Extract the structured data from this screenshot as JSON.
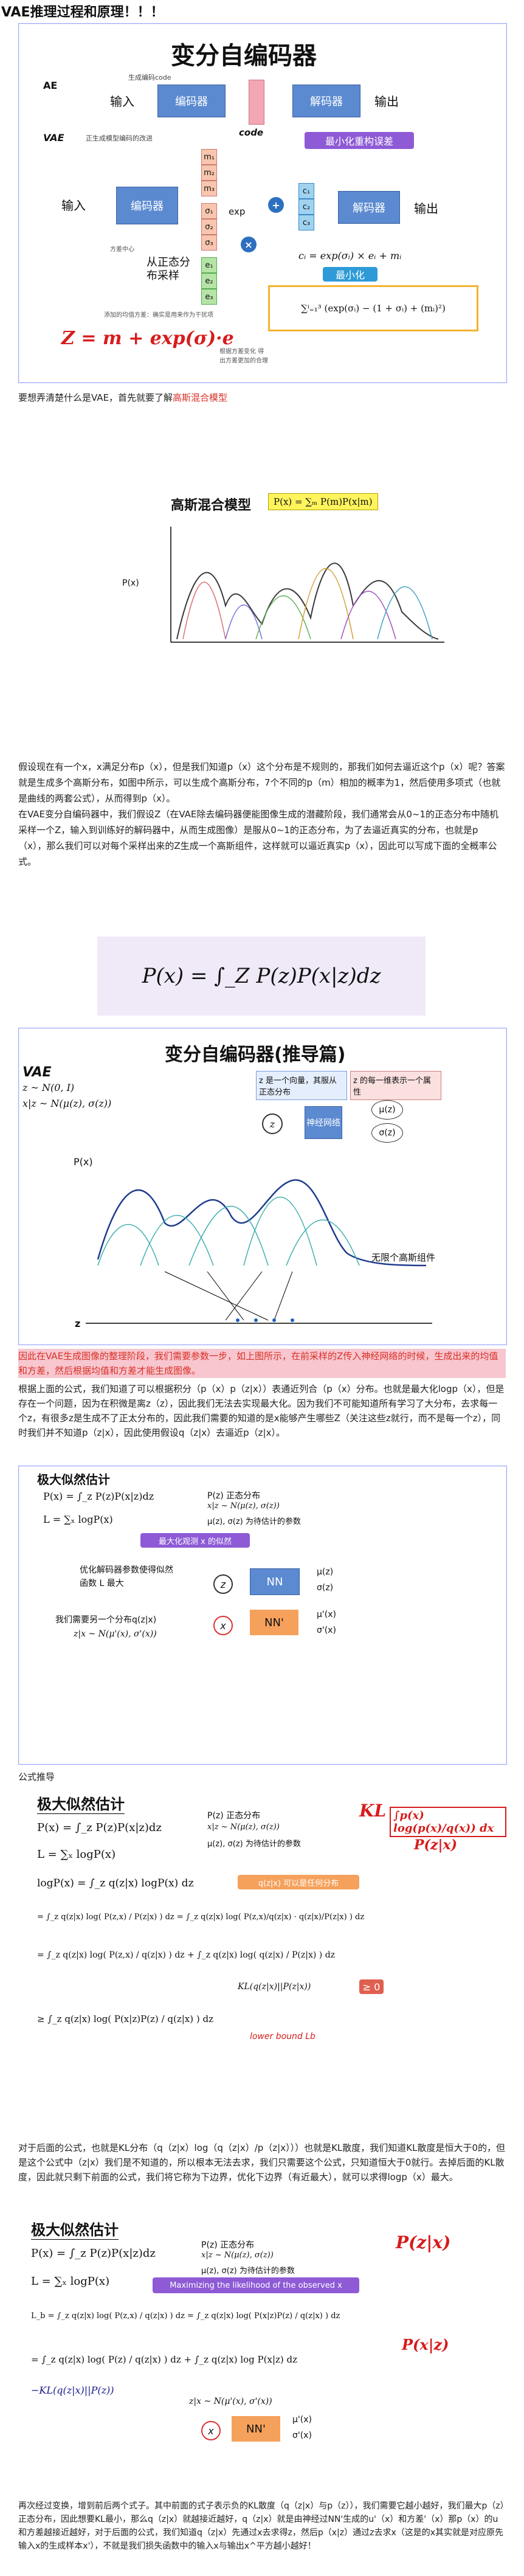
{
  "header": {
    "title": "VAE推理过程和原理！！！"
  },
  "slide1": {
    "title": "变分自编码器",
    "ae_label": "AE",
    "vae_label": "VAE",
    "gen_code_note": "生成编码code",
    "input": "输入",
    "encoder": "编码器",
    "code": "code",
    "decoder": "解码器",
    "output": "输出",
    "min_error": "最小化重构误差",
    "vae_gen_note": "正生成模型编码的改进",
    "means": [
      "m₁",
      "m₂",
      "m₃"
    ],
    "sigmas": [
      "σ₁",
      "σ₂",
      "σ₃"
    ],
    "es": [
      "e₁",
      "e₂",
      "e₃"
    ],
    "cs": [
      "c₁",
      "c₂",
      "c₃"
    ],
    "exp": "exp",
    "normal_sample": "从正态分布采样",
    "formula_c": "cᵢ = exp(σᵢ) × eᵢ + mᵢ",
    "minimize": "最小化",
    "loss": "∑ⁱ₌₁³ (exp(σᵢ) − (1 + σᵢ) + (mᵢ)²)",
    "handwritten": "Z = m + exp(σ)·e",
    "note_left": "方差中心",
    "note_bottom": "添加的均值方差：确实是用来作为干扰项",
    "note_right": "根据方差变化 得出方差更加的合理"
  },
  "para1": {
    "text": "要想弄清楚什么是VAE，首先就要了解",
    "red": "高斯混合模型"
  },
  "slide2": {
    "title": "高斯混合模型",
    "formula": "P(x) = ∑ₘ P(m)P(x|m)",
    "ylabel": "P(x)"
  },
  "para2": "假设现在有一个x，x满足分布p（x），但是我们知道p（x）这个分布是不规则的，那我们如何去逼近这个p（x）呢？答案就是生成多个高斯分布，如图中所示，可以生成个高斯分布，7个不同的p（m）相加的概率为1，然后使用多项式（也就是曲线的两套公式），从而得到p（x）。\n在VAE变分自编码器中，我们假设Z（在VAE除去编码器便能图像生成的潜藏阶段，我们通常会从0~1的正态分布中随机采样一个Z，输入到训练好的解码器中，从而生成图像）是服从0~1的正态分布，为了去逼近真实的分布，也就是p（x），那么我们可以对每个采样出来的Z生成一个高斯组件，这样就可以逼近真实p（x），因此可以写成下面的全概率公式。",
  "slide3": {
    "formula": "P(x) = ∫_Z P(z)P(x|z)dz"
  },
  "slide4": {
    "title": "变分自编码器(推导篇)",
    "vae": "VAE",
    "z_dist": "z ~ N(0, I)",
    "xz_dist": "x|z ~ N(μ(z), σ(z))",
    "note1": "z 是一个向量，其服从正态分布",
    "note2": "z 的每一维表示一个属性",
    "nn": "神经网络",
    "mu": "μ(z)",
    "sigma": "σ(z)",
    "px": "P(x)",
    "inf": "无限个高斯组件",
    "zaxis": "z"
  },
  "para3": {
    "red": "因此在VAE生成图像的整理阶段，我们需要参数一步，如上图所示，在前采样的Z传入神经网络的时候，生成出来的均值和方差，然后根据均值和方差才能生成图像。",
    "text": "根据上面的公式，我们知道了可以根据积分（p（x）p（z|x））表通近列合（p（x）分布。也就是最大化logp（x），但是存在一个问题，因为在积微是离z（z），因此我们无法去实现最大化。因为我们不可能知道所有学习了大分布，去求每一个z，有很多z是生成不了正太分布的，因此我们需要的知道的是x能够产生哪些Z（关注这些z就行，而不是每一个z），同时我们并不知道p（z|x），因此使用假设q（z|x）去逼近p（z|x）。"
  },
  "slide5": {
    "title": "极大似然估计",
    "f1": "P(x) = ∫_z P(z)P(x|z)dz",
    "f2": "L = ∑ₓ logP(x)",
    "pz": "P(z) 正态分布",
    "xz": "x|z ~ N(μ(z), σ(z))",
    "params": "μ(z), σ(z) 为待估计的参数",
    "maximize": "最大化观测 x 的似然",
    "opt": "优化解码器参数使得似然函数 L 最大",
    "need": "我们需要另一个分布q(z|x)",
    "nn": "NN",
    "nnp": "NN'",
    "mu": "μ(z)",
    "sigma": "σ(z)",
    "mup": "μ'(x)",
    "sigmap": "σ'(x)",
    "qzx": "z|x ~ N(μ'(x), σ'(x))",
    "z": "z",
    "x": "x"
  },
  "para4": "公式推导",
  "slide6": {
    "title": "极大似然估计",
    "f1": "P(x) = ∫_z P(z)P(x|z)dz",
    "f2": "L = ∑ₓ logP(x)",
    "pz": "P(z) 正态分布",
    "xz": "x|z ~ N(μ(z), σ(z))",
    "params": "μ(z), σ(z) 为待估计的参数",
    "logp1": "logP(x) = ∫_z q(z|x) logP(x) dz",
    "any": "q(z|x) 可以是任何分布",
    "logp2": "= ∫_z q(z|x) log( P(z,x) / P(z|x) ) dz = ∫_z q(z|x) log( P(z,x)/q(z|x) · q(z|x)/P(z|x) ) dz",
    "logp3": "= ∫_z q(z|x) log( P(z,x) / q(z|x) ) dz + ∫_z q(z|x) log( q(z|x) / P(z|x) ) dz",
    "kl": "KL(q(z|x)||P(z|x))",
    "ge0": "≥ 0",
    "logp4": "≥ ∫_z q(z|x) log( P(x|z)P(z) / q(z|x) ) dz",
    "lb": "lower bound  Lb",
    "hw1": "KL",
    "hw2": "∫p(x) log(p(x)/q(x)) dx",
    "hw3": "P(z|x)"
  },
  "para5": "对于后面的公式，也就是KL分布（q（z|x）log（q（z|x）/p（z|x）））也就是KL散度，我们知道KL散度是恒大于0的，但是这个公式中（z|x）我们是不知道的，所以根本无法去求，我们只需要这个公式，只知道恒大于0就行。去掉后面的KL散度，因此就只剩下前面的公式，我们将它称为下边界，优化下边界（有近最大），就可以求得logp（x）最大。",
  "slide7": {
    "title": "极大似然估计",
    "f1": "P(x) = ∫_z P(z)P(x|z)dz",
    "f2": "L = ∑ₓ logP(x)",
    "pz": "P(z) 正态分布",
    "xz": "x|z ~ N(μ(z), σ(z))",
    "params": "μ(z), σ(z) 为待估计的参数",
    "maxlabel": "Maximizing the likelihood of the observed x",
    "lb": "L_b = ∫_z q(z|x) log( P(z,x) / q(z|x) ) dz = ∫_z q(z|x) log( P(x|z)P(z) / q(z|x) ) dz",
    "lb2": "= ∫_z q(z|x) log( P(z) / q(z|x) ) dz + ∫_z q(z|x) log P(x|z) dz",
    "kl": "−KL(q(z|x)||P(z))",
    "qzx": "z|x ~ N(μ'(x), σ'(x))",
    "nnp": "NN'",
    "mup": "μ'(x)",
    "sigmap": "σ'(x)",
    "x": "x",
    "hw1": "P(z|x)",
    "hw2": "P(x|z)"
  },
  "para6": "再次经过变换，增到前后两个式子。其中前面的式子表示负的KL散度（q（z|x）与p（z）），我们需要它越小越好，我们最大p（z）正态分布，因此想要KL最小，那么q（z|x）就越接近越好，q（z|x）就是由神经过NN'生成的u'（x）和方差'（x）那p（x）的u和方差越接近越好，对于后面的公式，我们知道q（z|x）先通过x去求得z，然后p（x|z）通过z去求x（这是的x其实就是对应原先输入x的生成样本x'），不就是我们损失函数中的输入x与输出x^平方越小越好！"
}
